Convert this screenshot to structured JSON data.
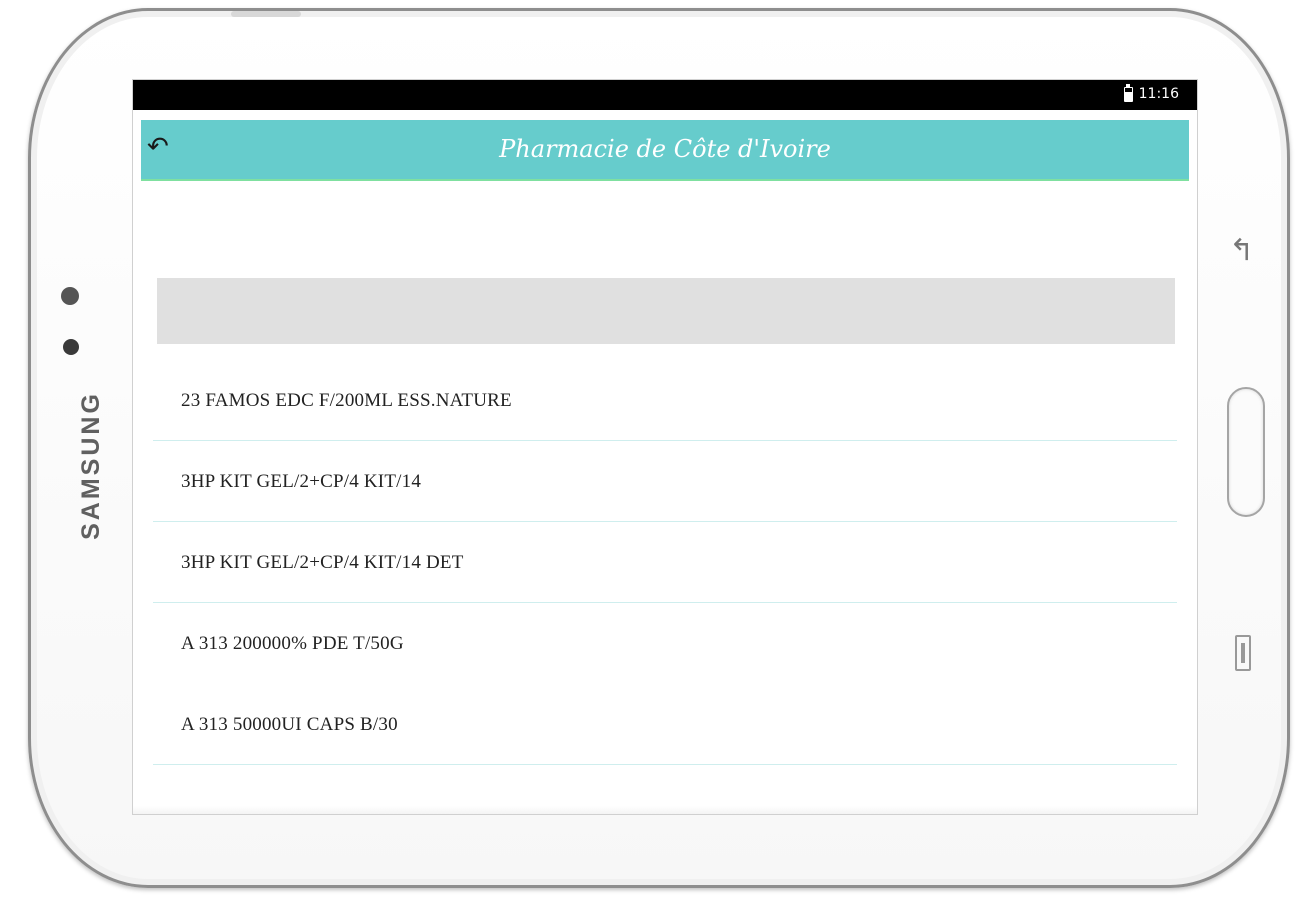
{
  "device": {
    "brand": "SAMSUNG"
  },
  "status_bar": {
    "time": "11:16",
    "icons": [
      "battery-icon"
    ]
  },
  "app_bar": {
    "title": "Pharmacie de Côte d'Ivoire",
    "back_icon": "back-arrow-icon",
    "color": "#66cccc"
  },
  "list": {
    "items": [
      {
        "label": "23 FAMOS EDC F/200ML ESS.NATURE"
      },
      {
        "label": "3HP KIT GEL/2+CP/4 KIT/14"
      },
      {
        "label": "3HP KIT GEL/2+CP/4 KIT/14 DET"
      },
      {
        "label": "A 313 200000% PDE T/50G"
      },
      {
        "label": "A 313 50000UI CAPS B/30"
      }
    ]
  }
}
